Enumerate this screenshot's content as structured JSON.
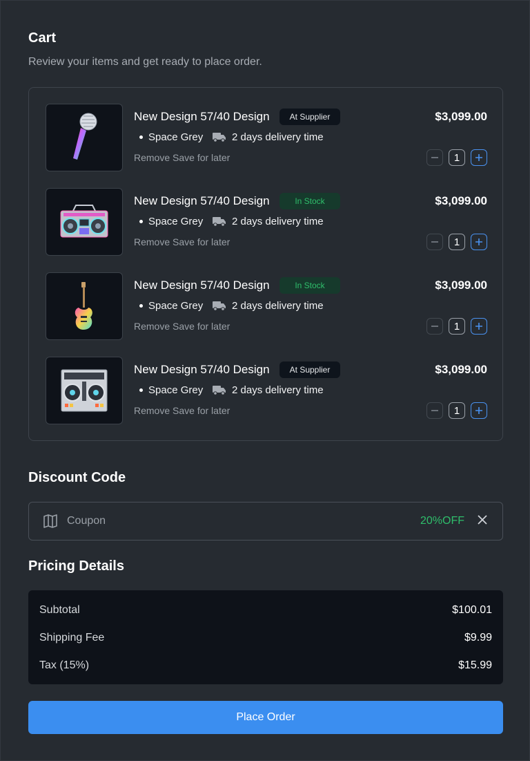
{
  "cart": {
    "title": "Cart",
    "subtitle": "Review your items and get ready to place order.",
    "items": [
      {
        "name": "New Design 57/40 Design",
        "badge": "At Supplier",
        "badge_type": "supplier",
        "color": "Space Grey",
        "delivery": "2 days delivery time",
        "remove_label": "Remove",
        "save_label": "Save for later",
        "price": "$3,099.00",
        "quantity": "1",
        "image": "microphone-image"
      },
      {
        "name": "New Design 57/40 Design",
        "badge": "In Stock",
        "badge_type": "stock",
        "color": "Space Grey",
        "delivery": "2 days delivery time",
        "remove_label": "Remove",
        "save_label": "Save for later",
        "price": "$3,099.00",
        "quantity": "1",
        "image": "boombox-image"
      },
      {
        "name": "New Design 57/40 Design",
        "badge": "In Stock",
        "badge_type": "stock",
        "color": "Space Grey",
        "delivery": "2 days delivery time",
        "remove_label": "Remove",
        "save_label": "Save for later",
        "price": "$3,099.00",
        "quantity": "1",
        "image": "guitar-image"
      },
      {
        "name": "New Design 57/40 Design",
        "badge": "At Supplier",
        "badge_type": "supplier",
        "color": "Space Grey",
        "delivery": "2 days delivery time",
        "remove_label": "Remove",
        "save_label": "Save for later",
        "price": "$3,099.00",
        "quantity": "1",
        "image": "dj-controller-image"
      }
    ]
  },
  "discount": {
    "title": "Discount Code",
    "placeholder": "Coupon",
    "applied_code": "20%OFF",
    "icon": "coupon-map-icon"
  },
  "pricing": {
    "title": "Pricing Details",
    "rows": [
      {
        "label": "Subtotal",
        "value": "$100.01"
      },
      {
        "label": "Shipping Fee",
        "value": "$9.99"
      },
      {
        "label": "Tax (15%)",
        "value": "$15.99"
      }
    ]
  },
  "order_button": {
    "label": "Place Order"
  },
  "colors": {
    "background": "#262b31",
    "panel": "#0e1219",
    "accent": "#3b8ef0",
    "success": "#2fbe6b"
  }
}
